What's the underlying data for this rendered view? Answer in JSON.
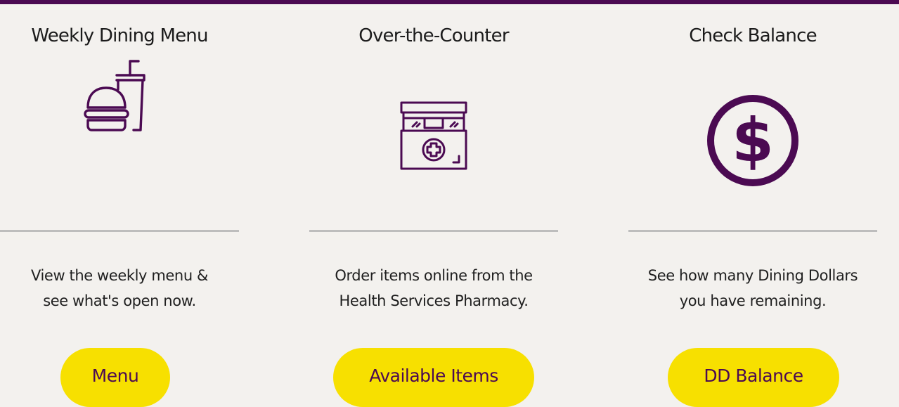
{
  "theme": {
    "accent": "#4b0a52",
    "button_bg": "#f7e000",
    "page_bg": "#f3f1ee",
    "divider": "#bdbdbd"
  },
  "cards": [
    {
      "title": "Weekly Dining Menu",
      "icon": "burger-drink-icon",
      "description_lines": [
        "View the weekly menu &",
        "see what's open now."
      ],
      "button_label": "Menu"
    },
    {
      "title": "Over-the-Counter",
      "icon": "pharmacy-store-icon",
      "description_lines": [
        "Order items online from the",
        "Health Services Pharmacy."
      ],
      "button_label": "Available Items"
    },
    {
      "title": "Check Balance",
      "icon": "dollar-circle-icon",
      "description_lines": [
        "See how many Dining Dollars",
        "you have remaining."
      ],
      "button_label": "DD Balance"
    }
  ]
}
